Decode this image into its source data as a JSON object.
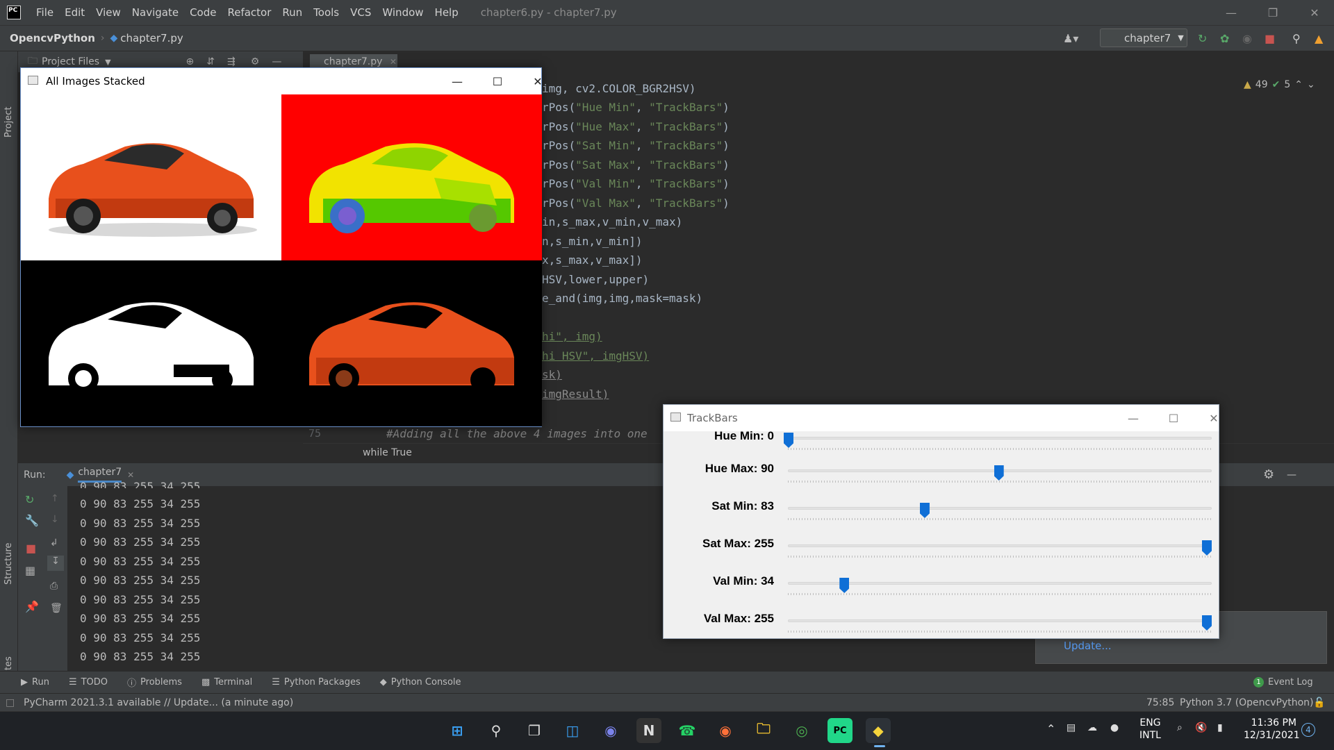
{
  "menubar": {
    "items": [
      "File",
      "Edit",
      "View",
      "Navigate",
      "Code",
      "Refactor",
      "Run",
      "Tools",
      "VCS",
      "Window",
      "Help"
    ],
    "window_title": "chapter6.py - chapter7.py"
  },
  "navbar": {
    "project": "OpencvPython",
    "file": "chapter7.py",
    "run_config": "chapter7"
  },
  "inspections": {
    "warnings": "49",
    "weak_warnings": "5"
  },
  "project_panel": {
    "title": "Project Files"
  },
  "editor": {
    "tab": "chapter7.py",
    "lines": [
      [
        "img, cv2.COLOR_BGR2HSV)"
      ],
      [
        "rPos(",
        "\"Hue Min\"",
        ", ",
        "\"TrackBars\"",
        ")"
      ],
      [
        "rPos(",
        "\"Hue Max\"",
        ", ",
        "\"TrackBars\"",
        ")"
      ],
      [
        "rPos(",
        "\"Sat Min\"",
        ", ",
        "\"TrackBars\"",
        ")"
      ],
      [
        "rPos(",
        "\"Sat Max\"",
        ", ",
        "\"TrackBars\"",
        ")"
      ],
      [
        "rPos(",
        "\"Val Min\"",
        ", ",
        "\"TrackBars\"",
        ")"
      ],
      [
        "rPos(",
        "\"Val Max\"",
        ", ",
        "\"TrackBars\"",
        ")"
      ]
    ],
    "plain_lines": [
      "in,s_max,v_min,v_max)",
      "n,s_min,v_min])",
      "x,s_max,v_max])",
      "HSV,lower,upper)",
      "e_and(img,img,mask=mask)"
    ],
    "tail_lines": [
      "hi\", img)",
      "hi HSV\", imgHSV)",
      "sk)",
      "imgResult)"
    ],
    "line_number": "75",
    "comment_line": "#Adding all the above 4 images into one",
    "breadcrumb": "while True"
  },
  "run_panel": {
    "label": "Run:",
    "tab": "chapter7",
    "output_partial": "0 90 83 255 34 255",
    "output_lines": [
      "0 90 83 255 34 255",
      "0 90 83 255 34 255",
      "0 90 83 255 34 255",
      "0 90 83 255 34 255",
      "0 90 83 255 34 255",
      "0 90 83 255 34 255",
      "0 90 83 255 34 255",
      "0 90 83 255 34 255",
      "0 90 83 255 34 255"
    ]
  },
  "left_strip": {
    "project": "Project",
    "structure": "Structure",
    "favorites": "Favorites"
  },
  "tool_tabs": [
    "Run",
    "TODO",
    "Problems",
    "Terminal",
    "Python Packages",
    "Python Console"
  ],
  "event_log": "Event Log",
  "status": {
    "message": "PyCharm 2021.3.1 available // Update... (a minute ago)",
    "position": "75:85",
    "interpreter": "Python 3.7 (OpencvPython)"
  },
  "notification": {
    "link": "Update..."
  },
  "images_window": {
    "title": "All Images Stacked"
  },
  "trackbars_window": {
    "title": "TrackBars",
    "bars": [
      {
        "label": "Hue Min: 0",
        "value": 0,
        "max": 179
      },
      {
        "label": "Hue Max: 90",
        "value": 90,
        "max": 179
      },
      {
        "label": "Sat Min: 83",
        "value": 83,
        "max": 255
      },
      {
        "label": "Sat Max: 255",
        "value": 255,
        "max": 255
      },
      {
        "label": "Val Min: 34",
        "value": 34,
        "max": 255
      },
      {
        "label": "Val Max: 255",
        "value": 255,
        "max": 255
      }
    ]
  },
  "taskbar": {
    "lang": "ENG",
    "layout": "INTL",
    "time": "11:36 PM",
    "date": "12/31/2021",
    "badge": "4"
  }
}
